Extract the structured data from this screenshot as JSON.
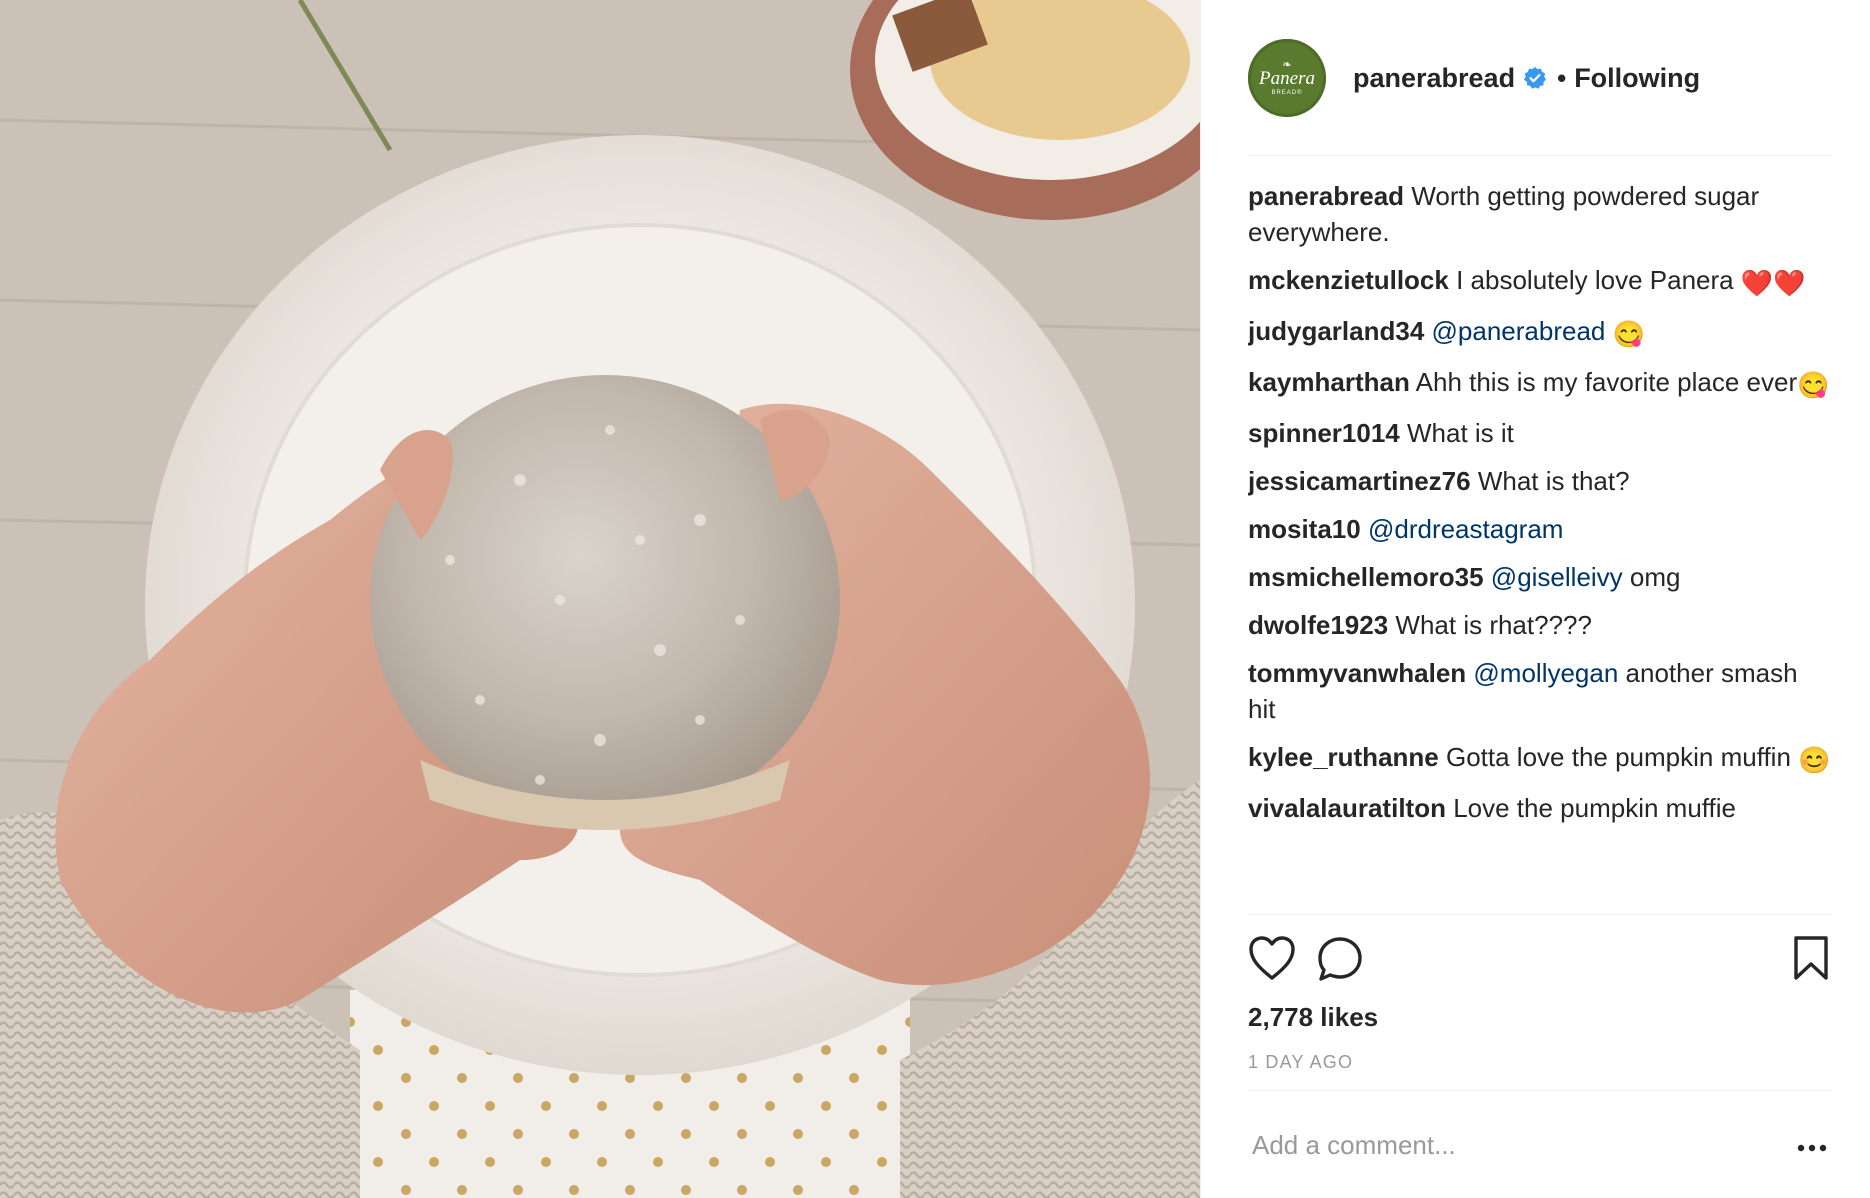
{
  "post": {
    "username": "panerabread",
    "verified": true,
    "follow_status": "Following",
    "separator": "•",
    "avatar": {
      "logo_text": "Panera",
      "logo_subtext": "BREAD®",
      "color": "#5a7a2e"
    },
    "likes_text": "2,778 likes",
    "timestamp": "1 DAY AGO",
    "comment_placeholder": "Add a comment...",
    "icons": [
      "heart-icon",
      "comment-icon",
      "bookmark-icon",
      "more-options-icon",
      "verified-badge-icon"
    ]
  },
  "comments": [
    {
      "user": "panerabread",
      "text": "Worth getting powdered sugar everywhere."
    },
    {
      "user": "mckenzietullock",
      "text": "I absolutely love Panera",
      "emoji": "❤️❤️"
    },
    {
      "user": "judygarland34",
      "mention": "@panerabread",
      "emoji": "😋"
    },
    {
      "user": "kaymharthan",
      "text": "Ahh this is my favorite place ever",
      "emoji": "😋"
    },
    {
      "user": "spinner1014",
      "text": "What is it"
    },
    {
      "user": "jessicamartinez76",
      "text": "What is that?"
    },
    {
      "user": "mosita10",
      "mention": "@drdreastagram"
    },
    {
      "user": "msmichellemoro35",
      "mention": "@giselleivy",
      "text": "omg"
    },
    {
      "user": "dwolfe1923",
      "text": "What is rhat????"
    },
    {
      "user": "tommyvanwhalen",
      "mention": "@mollyegan",
      "text": "another smash hit"
    },
    {
      "user": "kylee_ruthanne",
      "text": "Gotta love the pumpkin muffin",
      "emoji": "😊"
    },
    {
      "user": "vivalalauratilton",
      "text": "Love the pumpkin muffie"
    }
  ],
  "colors": {
    "link": "#003569",
    "muted": "#999999",
    "divider": "#efefef",
    "verified": "#3897f0",
    "like_red": "#ed4956"
  }
}
